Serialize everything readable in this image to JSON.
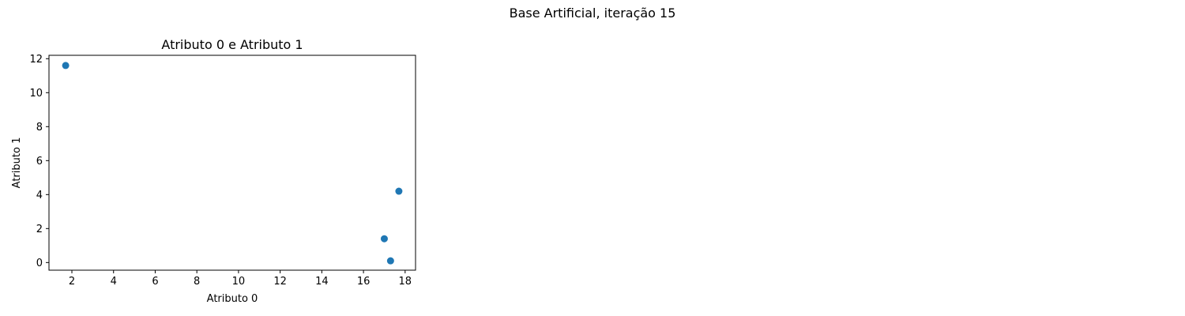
{
  "figure": {
    "suptitle": "Base Artificial, iteração 15"
  },
  "chart_data": {
    "type": "scatter",
    "title": "Atributo 0 e Atributo 1",
    "xlabel": "Atributo 0",
    "ylabel": "Atributo 1",
    "xlim": [
      0.9,
      18.5
    ],
    "ylim": [
      -0.45,
      12.2
    ],
    "xticks": [
      2,
      4,
      6,
      8,
      10,
      12,
      14,
      16,
      18
    ],
    "yticks": [
      0,
      2,
      4,
      6,
      8,
      10,
      12
    ],
    "grid": false,
    "point_color": "#1f77b4",
    "points": [
      {
        "x": 1.7,
        "y": 11.6
      },
      {
        "x": 17.7,
        "y": 4.2
      },
      {
        "x": 17.0,
        "y": 1.4
      },
      {
        "x": 17.3,
        "y": 0.1
      }
    ]
  }
}
